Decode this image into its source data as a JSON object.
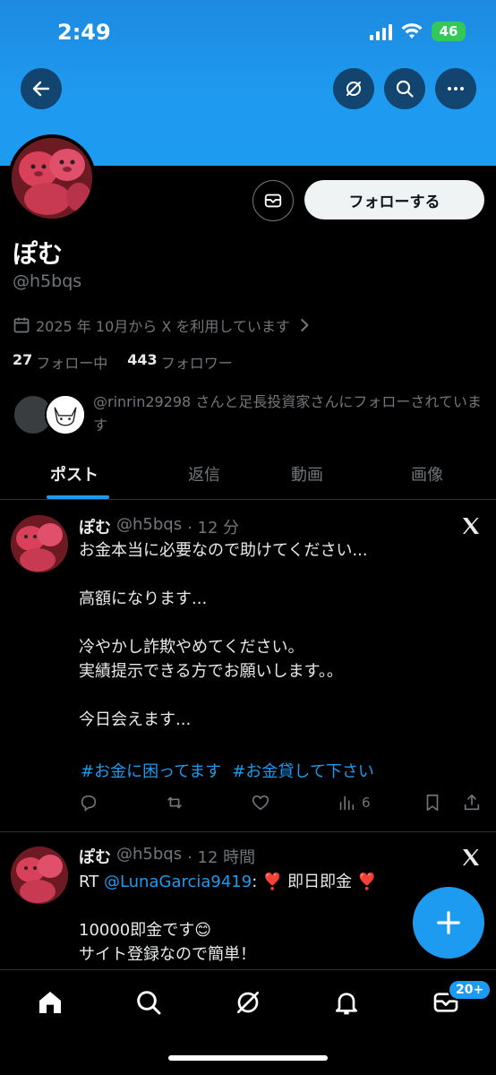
{
  "status_bar": {
    "time": "2:49",
    "battery": "46"
  },
  "profile": {
    "name": "ぽむ",
    "handle": "@h5bqs",
    "joined": "2025 年 10月から X を利用しています",
    "following_count": "27",
    "following_label": "フォロー中",
    "followers_count": "443",
    "followers_label": "フォロワー",
    "follow_button": "フォローする",
    "mutual_text": "@rinrin29298 さんと足長投資家さんにフォローされています"
  },
  "tabs": [
    {
      "label": "ポスト"
    },
    {
      "label": "返信"
    },
    {
      "label": "動画"
    },
    {
      "label": "画像"
    }
  ],
  "posts": [
    {
      "name": "ぽむ",
      "handle": "@h5bqs",
      "time": "· 12 分",
      "body": "お金本当に必要なので助けてください...\n\n高額になります...\n\n冷やかし詐欺やめてください。\n実績提示できる方でお願いします。。\n\n今日会えます...",
      "hashtags": [
        "#お金に困ってます",
        "#お金貸して下さい"
      ],
      "views": "6"
    },
    {
      "name": "ぽむ",
      "handle": "@h5bqs",
      "time": "· 12 時間",
      "rt_prefix": "RT",
      "mention": "@LunaGarcia9419",
      "rt_text": ": ❣️ 即日即金 ❣️",
      "body": "10000即金です😊\nサイト登録なので簡単！"
    }
  ],
  "bottom_nav": {
    "badge": "20+"
  },
  "colors": {
    "accent": "#1d9bf0",
    "background": "#000000",
    "muted": "#71767b"
  }
}
